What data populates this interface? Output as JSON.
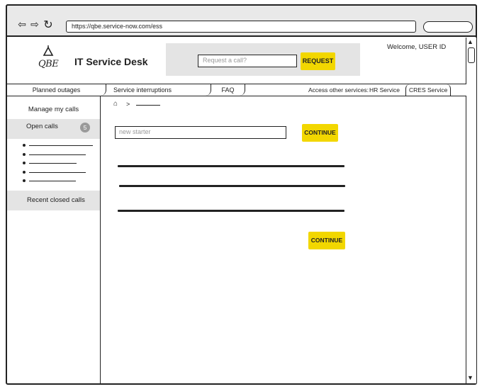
{
  "browser": {
    "url": "https://qbe.service-now.com/ess",
    "back_icon": "back-arrow-icon",
    "forward_icon": "forward-arrow-icon",
    "refresh_icon": "refresh-icon"
  },
  "header": {
    "logo_text": "QBE",
    "title": "IT Service Desk",
    "request_placeholder": "Request a call?",
    "request_button": "REQUEST",
    "welcome": "Welcome, USER ID"
  },
  "menu": {
    "items": [
      {
        "label": "Planned outages"
      },
      {
        "label": "Service interruptions"
      },
      {
        "label": "FAQ"
      }
    ],
    "access_label": "Access other services:",
    "hr_service": "HR Service",
    "cres_service": "CRES Service"
  },
  "sidebar": {
    "manage_label": "Manage my calls",
    "open_calls_label": "Open calls",
    "open_calls_count": "5",
    "recent_closed_label": "Recent closed calls"
  },
  "main": {
    "breadcrumb_home_icon": "home-icon",
    "breadcrumb_separator": ">",
    "search_placeholder": "new starter",
    "continue_label": "CONTINUE",
    "continue_label_bottom": "CONTINUE"
  },
  "colors": {
    "accent_yellow": "#f2d700",
    "panel_gray": "#e4e4e4",
    "chrome_gray": "#e9e9e9",
    "ink": "#222222"
  }
}
